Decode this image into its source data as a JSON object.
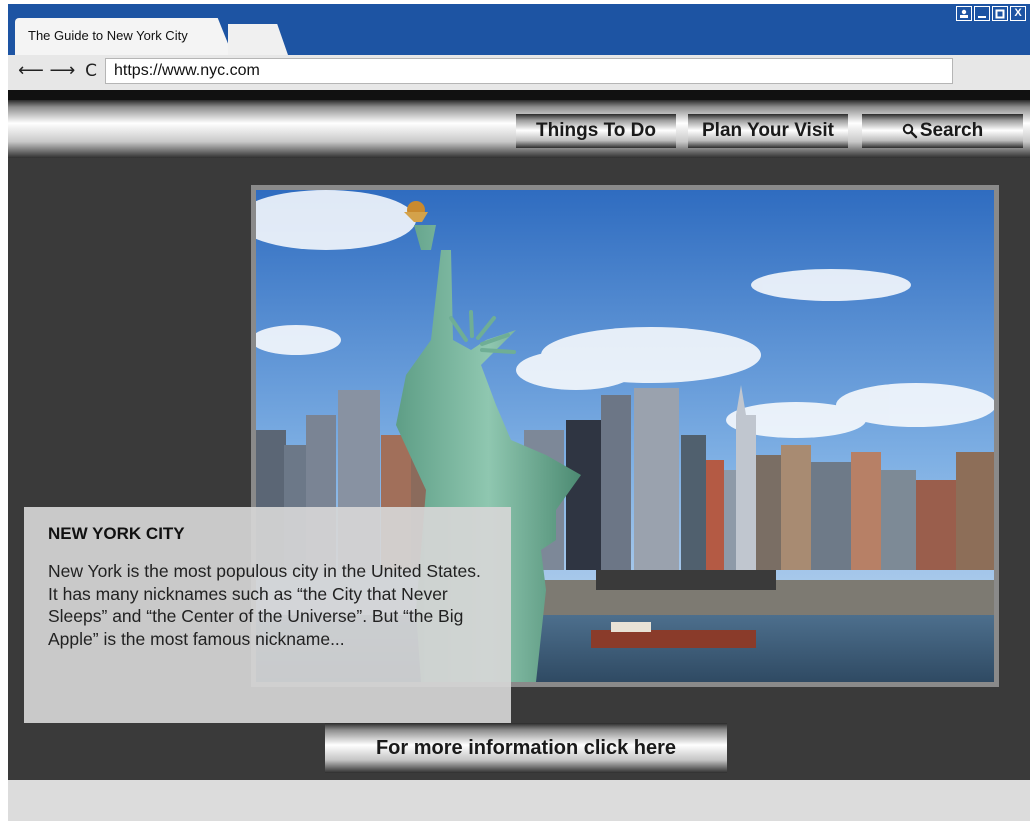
{
  "browser": {
    "tab_title": "The Guide to New York City",
    "nav_back": "⟵",
    "nav_forward": "⟶",
    "nav_reload": "C",
    "url": "https://www.nyc.com",
    "window_controls": [
      "user-icon",
      "minimize-icon",
      "maximize-icon",
      "close-icon"
    ],
    "close_label": "X"
  },
  "nav": {
    "items": [
      "Things To Do",
      "Plan Your Visit",
      "Search"
    ],
    "search_icon": "search-icon"
  },
  "hero": {
    "image": "statue-of-liberty-manhattan-skyline"
  },
  "info": {
    "title": "NEW YORK CITY",
    "text": "New York is the most populous city in the United States. It has many nicknames such as “the City that Never Sleeps” and “the Center of the Universe”. But “the Big Apple” is the most famous nickname..."
  },
  "cta": {
    "label": "For more information click here"
  },
  "colors": {
    "brand_blue": "#1d54a3",
    "page_dark": "#3a3a3a",
    "footer": "#dcdcdc"
  }
}
